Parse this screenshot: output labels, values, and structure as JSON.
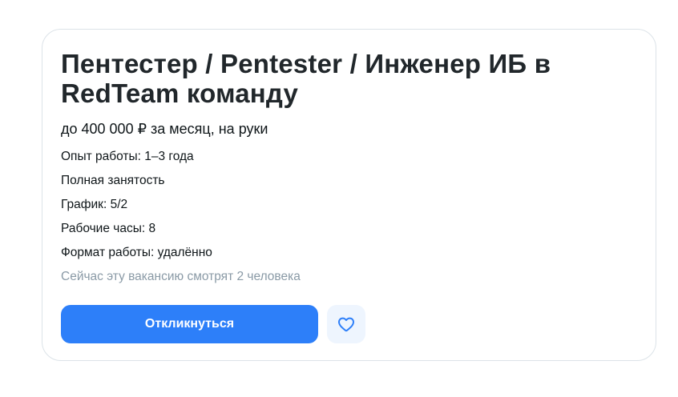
{
  "vacancy": {
    "title": "Пентестер / Pentester / Инженер ИБ в RedTeam команду",
    "salary": "до 400 000 ₽ за месяц, на руки",
    "details": [
      "Опыт работы: 1–3 года",
      "Полная занятость",
      "График: 5/2",
      "Рабочие часы: 8",
      "Формат работы: удалённо"
    ],
    "viewers": "Сейчас эту вакансию смотрят 2 человека"
  },
  "actions": {
    "respond_label": "Откликнуться",
    "favorite_icon": "heart-icon"
  },
  "colors": {
    "accent": "#2d7ff9",
    "favorite_bg": "#eef5fe",
    "muted_text": "#8a9aa6",
    "border": "#dce3e8"
  }
}
